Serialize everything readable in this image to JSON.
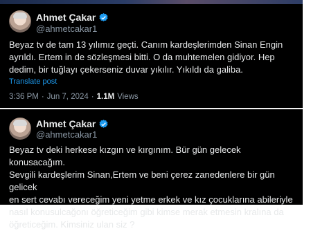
{
  "tweet1": {
    "author_name": "Ahmet Çakar",
    "handle": "@ahmetcakar1",
    "text": "Beyaz tv de tam 13 yılımız geçti. Canım kardeşlerimden Sinan Engin\nayrıldı. Ertem in de sözleşmesi bitti. O da muhtemelen gidiyor. Hep\ndedim, bir tuğlayı çekerseniz duvar yıkılır. Yıkıldı da galiba.",
    "translate_label": "Translate post",
    "time": "3:36 PM",
    "date": "Jun 7, 2024",
    "views_count": "1.1M",
    "views_label": "Views"
  },
  "tweet2": {
    "author_name": "Ahmet Çakar",
    "handle": "@ahmetcakar1",
    "text": "Beyaz tv deki herkese kızgın ve kırgınım. Bür gün gelecek konusacağım.\nSevgili kardeşlerim Sinan,Ertem ve beni çerez zanedenlere bir gün gelicek\nen sert cevabı vereceğim yeni yetme erkek ve kız çocuklarına abileriyle\nnasıl konusulcağonı öğreticeğim gibi kimse merak etmesin kralına da\nöğreticeğim. Kimsiniz ulan siz ?"
  },
  "colors": {
    "background": "#000000",
    "text": "#e7e9ea",
    "secondary": "#8b98a5",
    "accent": "#1d9bf0"
  },
  "icons": [
    "verified-badge-icon",
    "avatar"
  ]
}
